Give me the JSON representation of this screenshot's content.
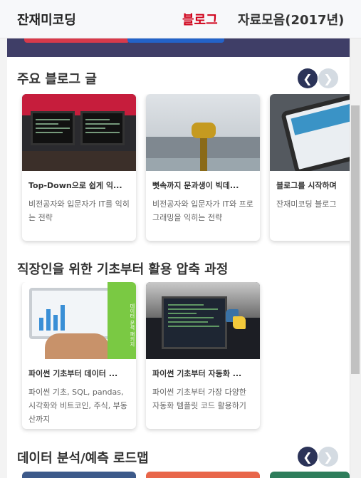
{
  "header": {
    "brand": "잔재미코딩",
    "nav_blog": "블로그",
    "nav_archive": "자료모음(2017년)"
  },
  "colors": {
    "brand_red": "#d0021b",
    "arrow_active": "#2b3358",
    "arrow_inactive": "#d4dbe2"
  },
  "sections": {
    "featured": {
      "title": "주요 블로그 글",
      "prev_icon": "chevron-left-icon",
      "next_icon": "chevron-right-icon",
      "cards": [
        {
          "title": "Top-Down으로 쉽게 익...",
          "desc": "비전공자와 입문자가 IT를 익히는 전략"
        },
        {
          "title": "뼛속까지 문과생이 빅데...",
          "desc": "비전공자와 입문자가 IT와 프로그래밍을 익히는 전략"
        },
        {
          "title": "블로그를 시작하며",
          "desc": "잔재미코딩 블로그"
        }
      ]
    },
    "courses": {
      "title": "직장인을 위한 기초부터 활용 압축 과정",
      "cards": [
        {
          "title": "파이썬 기초부터 데이터 ...",
          "desc": "파이썬 기초, SQL, pandas, 시각화와 비트코인, 주식, 부동산까지",
          "thumb_text": "데이터 분석 패키지"
        },
        {
          "title": "파이썬 기초부터 자동화 ...",
          "desc": "파이썬 기초부터 가장 다양한 자동화 템플릿 코드 활용하기"
        }
      ]
    },
    "roadmap": {
      "title": "데이터 분석/예측 로드맵"
    }
  }
}
